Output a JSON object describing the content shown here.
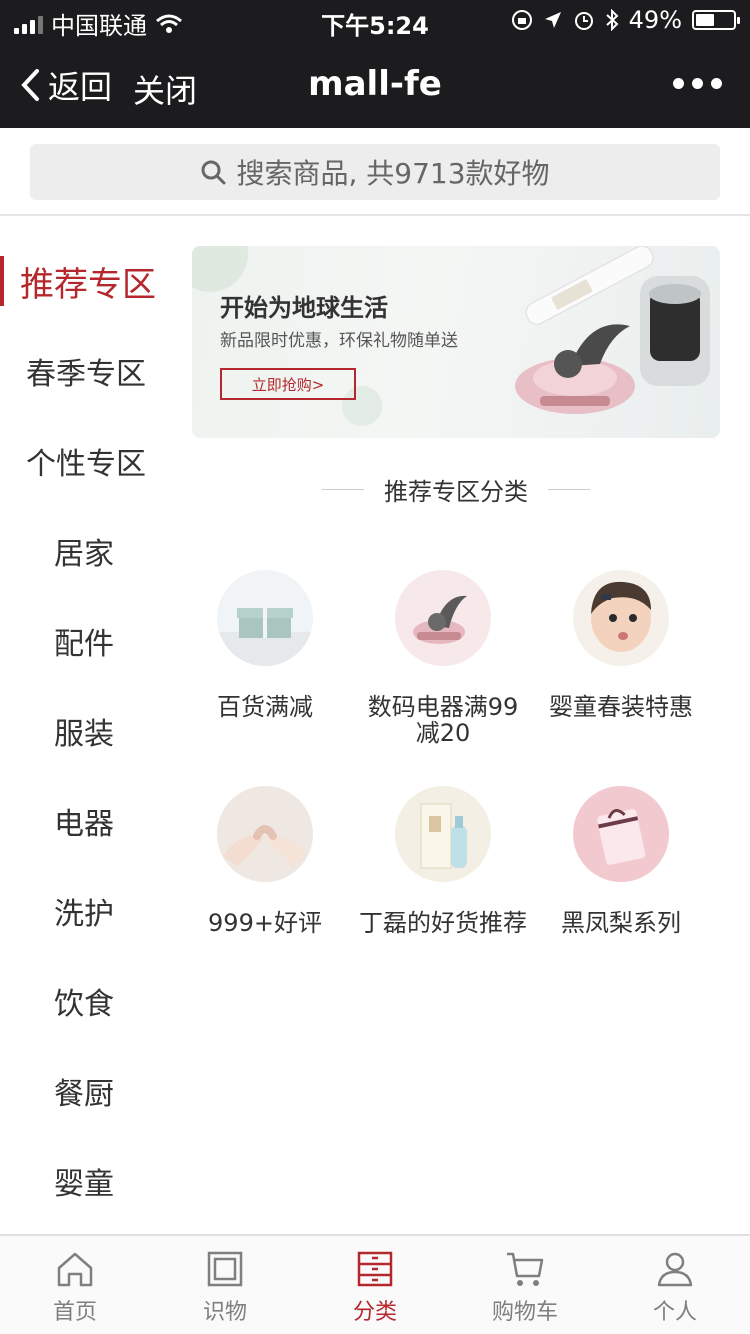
{
  "status_bar": {
    "carrier": "中国联通",
    "time": "下午5:24",
    "battery_percent": "49%",
    "battery_level": 0.49
  },
  "navbar": {
    "back_label": "返回",
    "close_label": "关闭",
    "title": "mall-fe"
  },
  "search": {
    "placeholder": "搜索商品, 共9713款好物"
  },
  "sidebar": {
    "items": [
      {
        "label": "推荐专区",
        "active": true
      },
      {
        "label": "春季专区"
      },
      {
        "label": "个性专区"
      },
      {
        "label": "居家"
      },
      {
        "label": "配件"
      },
      {
        "label": "服装"
      },
      {
        "label": "电器"
      },
      {
        "label": "洗护"
      },
      {
        "label": "饮食"
      },
      {
        "label": "餐厨"
      },
      {
        "label": "婴童"
      }
    ]
  },
  "banner": {
    "title": "开始为地球生活",
    "subtitle": "新品限时优惠，环保礼物随单送",
    "button": "立即抢购>"
  },
  "section": {
    "title": "推荐专区分类"
  },
  "categories": [
    {
      "label": "百货满减",
      "icon": "gift-box-icon"
    },
    {
      "label": "数码电器满99减20",
      "icon": "handheld-vacuum-icon"
    },
    {
      "label": "婴童春装特惠",
      "icon": "baby-photo-icon"
    },
    {
      "label": "999+好评",
      "icon": "pinky-promise-icon"
    },
    {
      "label": "丁磊的好货推荐",
      "icon": "wine-bottle-icon"
    },
    {
      "label": "黑凤梨系列",
      "icon": "pink-gift-icon"
    }
  ],
  "tabbar": {
    "items": [
      {
        "label": "首页",
        "icon": "home-icon"
      },
      {
        "label": "识物",
        "icon": "square-icon"
      },
      {
        "label": "分类",
        "icon": "category-icon",
        "active": true
      },
      {
        "label": "购物车",
        "icon": "cart-icon"
      },
      {
        "label": "个人",
        "icon": "person-icon"
      }
    ]
  },
  "colors": {
    "accent": "#b4282d",
    "header_bg": "#1c1c1e"
  }
}
